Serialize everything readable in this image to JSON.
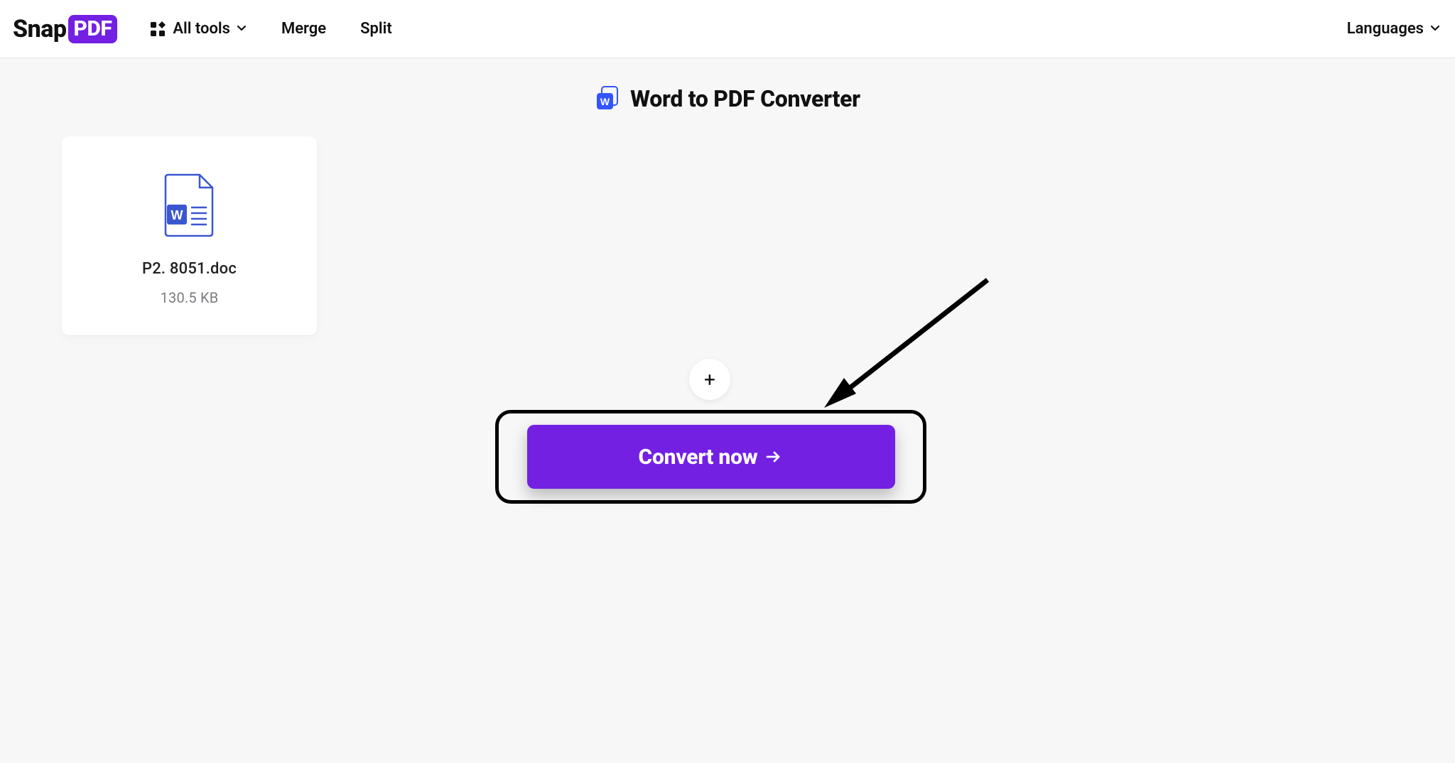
{
  "brand": {
    "name_left": "Snap",
    "name_right": "PDF"
  },
  "nav": {
    "all_tools": "All tools",
    "merge": "Merge",
    "split": "Split"
  },
  "languages_label": "Languages",
  "page_title": "Word to PDF Converter",
  "file": {
    "name": "P2. 8051.doc",
    "size": "130.5 KB"
  },
  "add_button_glyph": "+",
  "convert_button_label": "Convert now"
}
